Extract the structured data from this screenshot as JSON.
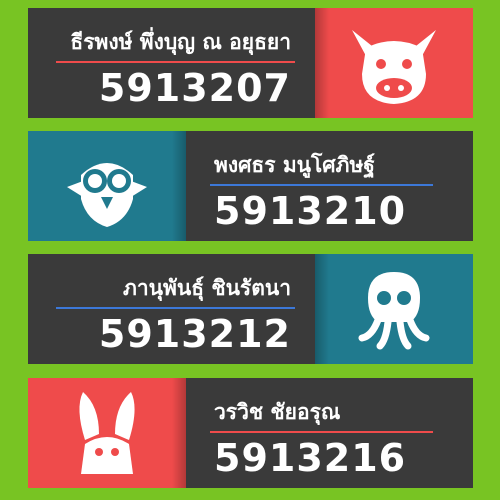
{
  "cards": [
    {
      "name": "ธีรพงษ์ พึ่งบุญ ณ อยุธยา",
      "id": "5913207",
      "icon": "cow-icon",
      "icon_color": "#ef4b4b"
    },
    {
      "name": "พงศธร มนูโศภิษฐ์",
      "id": "5913210",
      "icon": "owl-icon",
      "icon_color": "#207a8e"
    },
    {
      "name": "ภานุพันธุ์ ชินรัตนา",
      "id": "5913212",
      "icon": "octopus-icon",
      "icon_color": "#207a8e"
    },
    {
      "name": "วรวิช ชัยอรุณ",
      "id": "5913216",
      "icon": "rabbit-icon",
      "icon_color": "#ef4b4b"
    }
  ],
  "colors": {
    "background": "#78c423",
    "card": "#3a3a3a",
    "red": "#ef4b4b",
    "teal": "#207a8e",
    "blue_line": "#3c78d8"
  }
}
